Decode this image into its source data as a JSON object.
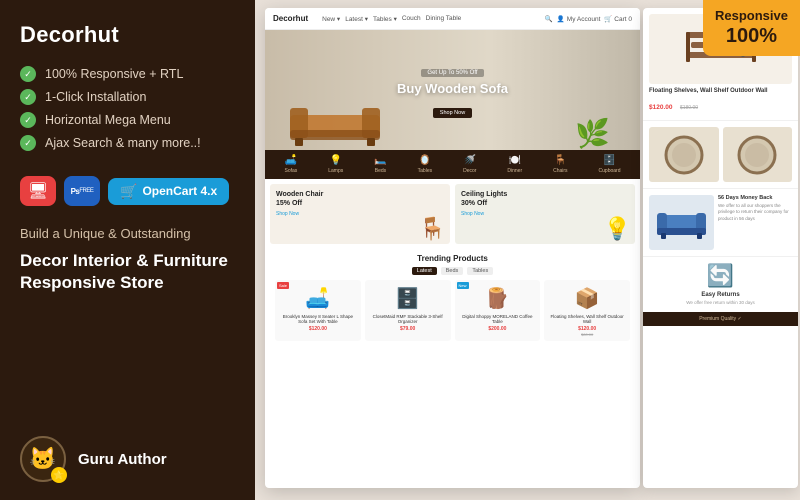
{
  "left": {
    "title": "Decorhut",
    "features": [
      "100% Responsive + RTL",
      "1-Click Installation",
      "Horizontal Mega Menu",
      "Ajax Search & many more..!"
    ],
    "badges": {
      "opencart_label": "OpenCart 4.x"
    },
    "tagline_small": "Build a Unique & Outstanding",
    "tagline_big": "Decor Interior & Furniture Responsive Store",
    "author": {
      "name": "Guru Author"
    }
  },
  "responsive_badge": {
    "line1": "Responsive",
    "line2": "100%"
  },
  "hero": {
    "sub": "Get Up To 50% Off",
    "title": "Buy Wooden Sofa",
    "btn": "Shop Now"
  },
  "categories": [
    {
      "icon": "🛋️",
      "label": "Sofas"
    },
    {
      "icon": "💡",
      "label": "Lamps"
    },
    {
      "icon": "🛏️",
      "label": "Beds"
    },
    {
      "icon": "🪞",
      "label": "Tables"
    },
    {
      "icon": "🚿",
      "label": "Decor"
    },
    {
      "icon": "🪑",
      "label": "Dinner"
    },
    {
      "icon": "🪑",
      "label": "Chairs"
    },
    {
      "icon": "🗄️",
      "label": "Cupboard"
    }
  ],
  "promos": [
    {
      "title": "Wooden Chair\n15% Off",
      "btn": "Shop Now",
      "icon": "🪑"
    },
    {
      "title": "Ceiling Lights\n30% Off",
      "btn": "Shop Now",
      "icon": "💡"
    }
  ],
  "trending": {
    "title": "Trending Products",
    "filters": [
      "Latest",
      "Beds",
      "Tables"
    ]
  },
  "products": [
    {
      "name": "Brooklyn Massey 8 Seater L Shape Sofa Set With Table",
      "price": "$120.00",
      "old_price": "",
      "icon": "🛋️",
      "badge": "Sale"
    },
    {
      "name": "ClosetMaid RMF Stackable 3-Shelf Organizer",
      "price": "$79.00",
      "old_price": "",
      "icon": "🗄️",
      "badge": ""
    },
    {
      "name": "Digital Shoppy MORELAND Coffee Table",
      "price": "$200.00",
      "old_price": "",
      "icon": "🪵",
      "badge": "New"
    },
    {
      "name": "Floating Shelves, Wall Shelf Outdoor Wall",
      "price": "$120.00",
      "old_price": "$80.00",
      "icon": "📦",
      "badge": ""
    }
  ],
  "side": {
    "shelf_icon": "🗂️",
    "shelf_name": "Floating Shelves, Wall Shelf Outdoor Wall",
    "shelf_price": "$120.00",
    "shelf_old": "$180.00",
    "mirror_icons": [
      "🪞",
      "🪞"
    ],
    "sofa_icon": "🛋️",
    "sofa_title": "56 Days Money Back",
    "sofa_text": "We offer to all our shoppers the privilege to return their company for product in 56 days",
    "trust_icon": "🔄",
    "trust_title": "Easy Returns",
    "trust_text": "We offer free return within 30 days"
  },
  "nav": {
    "logo": "Decorhut",
    "links": [
      "New ▾",
      "Latest ▾",
      "Tables ▾",
      "Couch",
      "Dining Table"
    ],
    "icons": [
      "🔍 Search",
      "👤 My Account",
      "🛒 Cart 0"
    ]
  }
}
